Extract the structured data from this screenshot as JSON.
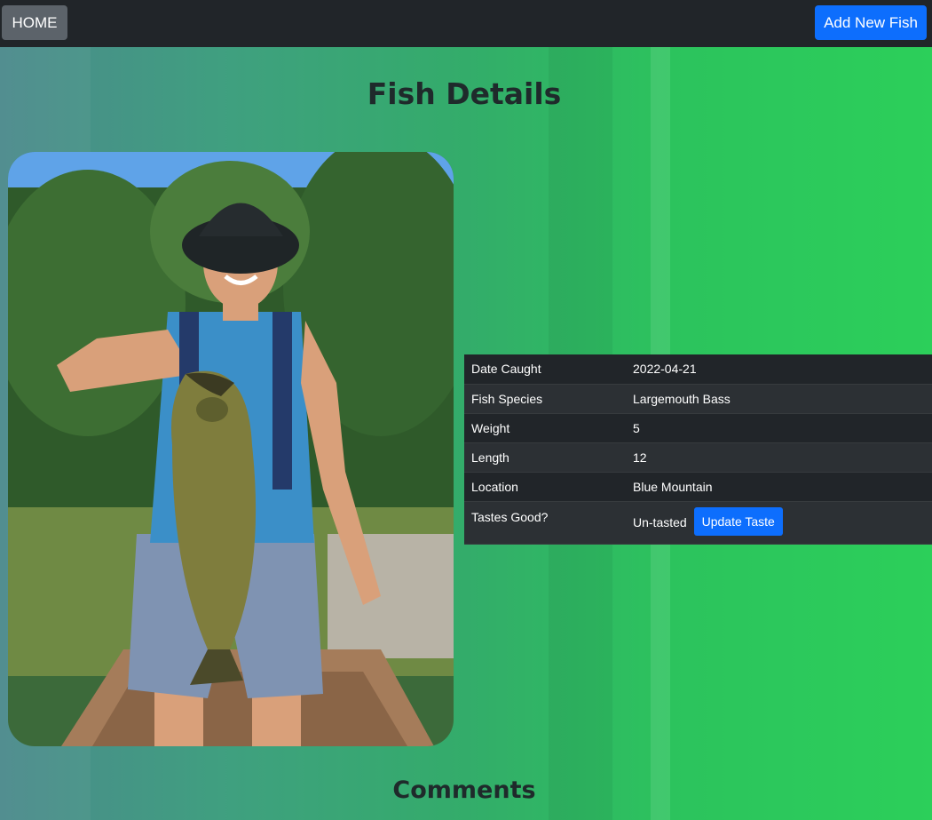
{
  "nav": {
    "home_label": "HOME",
    "add_label": "Add New Fish"
  },
  "page": {
    "title": "Fish Details",
    "comments_heading": "Comments"
  },
  "fish": {
    "rows": [
      {
        "label": "Date Caught",
        "value": "2022-04-21"
      },
      {
        "label": "Fish Species",
        "value": "Largemouth Bass"
      },
      {
        "label": "Weight",
        "value": "5"
      },
      {
        "label": "Length",
        "value": "12"
      },
      {
        "label": "Location",
        "value": "Blue Mountain"
      }
    ],
    "taste": {
      "label": "Tastes Good?",
      "value": "Un-tasted",
      "button_label": "Update Taste"
    }
  },
  "colors": {
    "navbar": "#212529",
    "primary": "#0d6efd",
    "secondary": "#5c636a",
    "table_bg": "#212529"
  }
}
